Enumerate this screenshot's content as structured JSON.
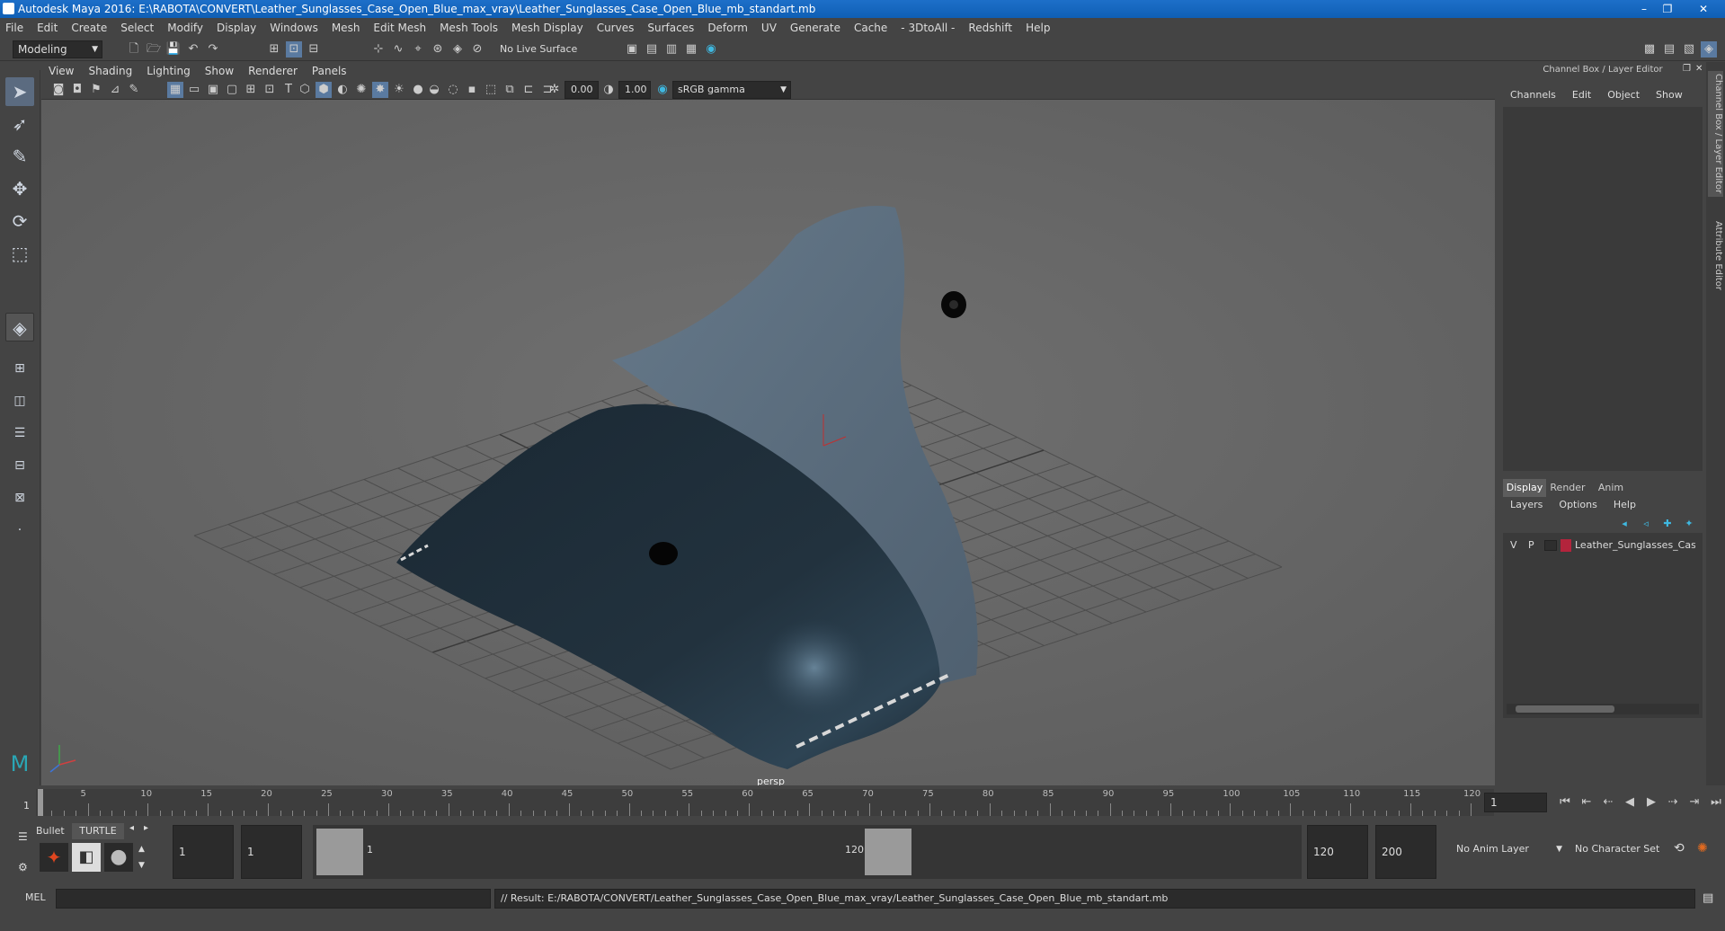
{
  "window": {
    "title": "Autodesk Maya 2016: E:\\RABOTA\\CONVERT\\Leather_Sunglasses_Case_Open_Blue_max_vray\\Leather_Sunglasses_Case_Open_Blue_mb_standart.mb"
  },
  "menu": [
    "File",
    "Edit",
    "Create",
    "Select",
    "Modify",
    "Display",
    "Windows",
    "Mesh",
    "Edit Mesh",
    "Mesh Tools",
    "Mesh Display",
    "Curves",
    "Surfaces",
    "Deform",
    "UV",
    "Generate",
    "Cache",
    "- 3DtoAll -",
    "Redshift",
    "Help"
  ],
  "shelf": {
    "mode": "Modeling",
    "live_surface": "No Live Surface"
  },
  "viewport": {
    "menu": [
      "View",
      "Shading",
      "Lighting",
      "Show",
      "Renderer",
      "Panels"
    ],
    "exposure": "0.00",
    "gamma": "1.00",
    "color_space": "sRGB gamma",
    "camera_label": "persp"
  },
  "channel_box": {
    "title": "Channel Box / Layer Editor",
    "menu": [
      "Channels",
      "Edit",
      "Object",
      "Show"
    ],
    "side_tabs": [
      "Channel Box / Layer Editor",
      "Attribute Editor"
    ]
  },
  "layer_editor": {
    "tabs": [
      "Display",
      "Render",
      "Anim"
    ],
    "active_tab": "Display",
    "menu": [
      "Layers",
      "Options",
      "Help"
    ],
    "layers": [
      {
        "v": "V",
        "p": "P",
        "color": "#b3243c",
        "name": "Leather_Sunglasses_Case"
      }
    ]
  },
  "timeline": {
    "ticks": [
      "5",
      "10",
      "15",
      "20",
      "25",
      "30",
      "35",
      "40",
      "45",
      "50",
      "55",
      "60",
      "65",
      "70",
      "75",
      "80",
      "85",
      "90",
      "95",
      "100",
      "105",
      "110",
      "115",
      "120"
    ],
    "start_label": "1",
    "current_frame": "1"
  },
  "range": {
    "shelf_tabs": [
      "Bullet",
      "TURTLE"
    ],
    "start_frame": "1",
    "playback_start": "1",
    "range_start": "1",
    "range_end": "120",
    "playback_end": "120",
    "end_frame": "200",
    "anim_layer": "No Anim Layer",
    "character_set": "No Character Set"
  },
  "command": {
    "language": "MEL",
    "result": "// Result: E:/RABOTA/CONVERT/Leather_Sunglasses_Case_Open_Blue_max_vray/Leather_Sunglasses_Case_Open_Blue_mb_standart.mb"
  },
  "colors": {
    "titlebar": "#1565c0",
    "viewport_bg": "#686868",
    "case_dark": "#1d2d38",
    "case_suede": "#5f7384",
    "layer_color": "#b3243c"
  }
}
